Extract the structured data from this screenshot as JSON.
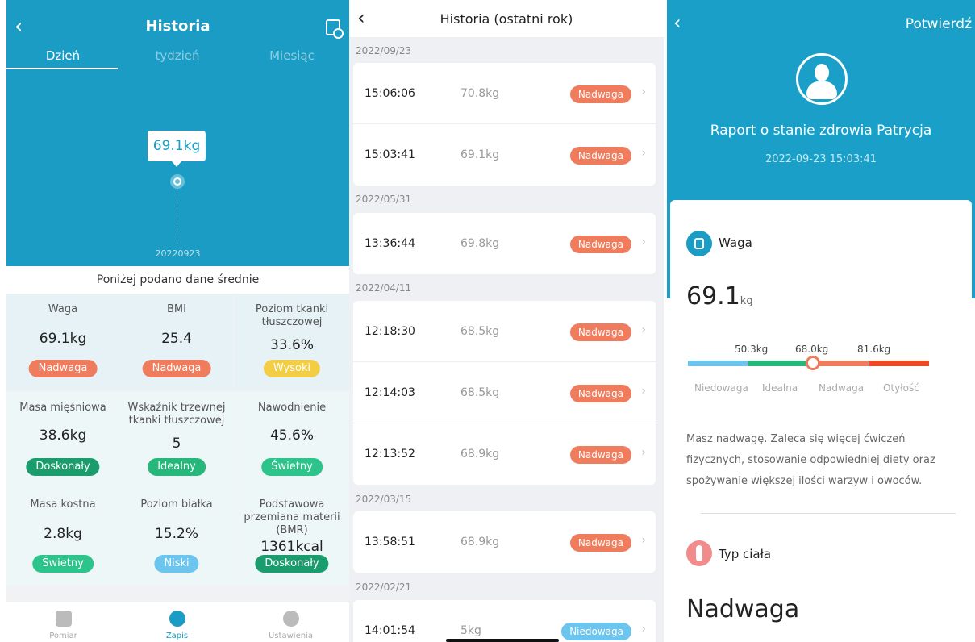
{
  "panel1": {
    "title": "Historia",
    "tabs": [
      "Dzień",
      "tydzień",
      "Miesiąc"
    ],
    "bubble": "69.1kg",
    "date_label": "20220923",
    "avg_label": "Poniżej podano dane średnie",
    "metrics": [
      {
        "label": "Waga",
        "value": "69.1kg",
        "badge": "Nadwaga",
        "color": "#f07c5e"
      },
      {
        "label": "BMI",
        "value": "25.4",
        "badge": "Nadwaga",
        "color": "#f07c5e"
      },
      {
        "label": "Poziom tkanki tłuszczowej",
        "value": "33.6%",
        "badge": "Wysoki",
        "color": "#f4cd46"
      },
      {
        "label": "Masa mięśniowa",
        "value": "38.6kg",
        "badge": "Doskonały",
        "color": "#1a9c6c"
      },
      {
        "label": "Wskaźnik trzewnej tkanki tłuszczowej",
        "value": "5",
        "badge": "Idealny",
        "color": "#26b87a"
      },
      {
        "label": "Nawodnienie",
        "value": "45.6%",
        "badge": "Świetny",
        "color": "#2cc48a"
      },
      {
        "label": "Masa kostna",
        "value": "2.8kg",
        "badge": "Świetny",
        "color": "#2cc48a"
      },
      {
        "label": "Poziom białka",
        "value": "15.2%",
        "badge": "Niski",
        "color": "#6cc5ee"
      },
      {
        "label": "Podstawowa przemiana materii (BMR)",
        "value": "1361kcal",
        "badge": "Doskonały",
        "color": "#1a9c6c"
      }
    ],
    "nav": [
      "Pomiar",
      "Zapis",
      "Ustawienia"
    ]
  },
  "panel2": {
    "title": "Historia (ostatni rok)",
    "groups": [
      {
        "date": "2022/09/23",
        "rows": [
          {
            "time": "15:06:06",
            "weight": "70.8kg",
            "badge": "Nadwaga"
          },
          {
            "time": "15:03:41",
            "weight": "69.1kg",
            "badge": "Nadwaga"
          }
        ]
      },
      {
        "date": "2022/05/31",
        "rows": [
          {
            "time": "13:36:44",
            "weight": "69.8kg",
            "badge": "Nadwaga"
          }
        ]
      },
      {
        "date": "2022/04/11",
        "rows": [
          {
            "time": "12:18:30",
            "weight": "68.5kg",
            "badge": "Nadwaga"
          },
          {
            "time": "12:14:03",
            "weight": "68.5kg",
            "badge": "Nadwaga"
          },
          {
            "time": "12:13:52",
            "weight": "68.9kg",
            "badge": "Nadwaga"
          }
        ]
      },
      {
        "date": "2022/03/15",
        "rows": [
          {
            "time": "13:58:51",
            "weight": "68.9kg",
            "badge": "Nadwaga"
          }
        ]
      },
      {
        "date": "2022/02/21",
        "rows": [
          {
            "time": "14:01:54",
            "weight": "5kg",
            "badge": "Niedowaga"
          }
        ]
      }
    ]
  },
  "panel3": {
    "confirm": "Potwierdź",
    "report": "Raport o stanie zdrowia Patrycja",
    "datetime": "2022-09-23 15:03:41",
    "weight_title": "Waga",
    "weight_value": "69.1",
    "weight_unit": "kg",
    "thresholds": [
      "50.3kg",
      "68.0kg",
      "81.6kg"
    ],
    "categories": [
      "Niedowaga",
      "Idealna",
      "Nadwaga",
      "Otyłość"
    ],
    "description": "Masz nadwagę. Zaleca się więcej ćwiczeń fizycznych, stosowanie odpowiedniej diety oraz spożywanie większej ilości warzyw i owoców.",
    "body_title": "Typ ciała",
    "body_value": "Nadwaga"
  }
}
